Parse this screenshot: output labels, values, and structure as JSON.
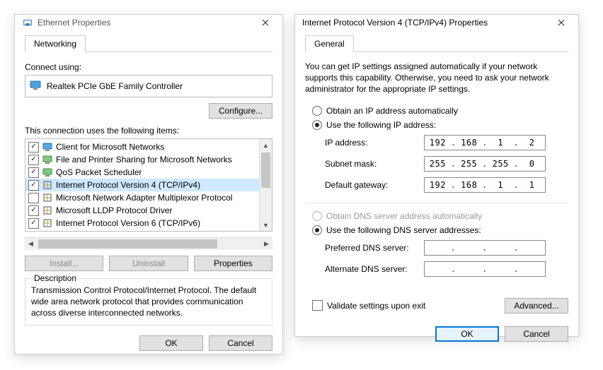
{
  "left": {
    "title": "Ethernet Properties",
    "tab": "Networking",
    "connect_using_label": "Connect using:",
    "adapter": "Realtek PCIe GbE Family Controller",
    "configure_btn": "Configure...",
    "items_label": "This connection uses the following items:",
    "items": [
      {
        "checked": true,
        "icon": "client",
        "label": "Client for Microsoft Networks",
        "selected": false
      },
      {
        "checked": true,
        "icon": "service",
        "label": "File and Printer Sharing for Microsoft Networks",
        "selected": false
      },
      {
        "checked": true,
        "icon": "service",
        "label": "QoS Packet Scheduler",
        "selected": false
      },
      {
        "checked": true,
        "icon": "protocol",
        "label": "Internet Protocol Version 4 (TCP/IPv4)",
        "selected": true
      },
      {
        "checked": false,
        "icon": "protocol",
        "label": "Microsoft Network Adapter Multiplexor Protocol",
        "selected": false
      },
      {
        "checked": true,
        "icon": "protocol",
        "label": "Microsoft LLDP Protocol Driver",
        "selected": false
      },
      {
        "checked": true,
        "icon": "protocol",
        "label": "Internet Protocol Version 6 (TCP/IPv6)",
        "selected": false
      }
    ],
    "install_btn": "Install...",
    "uninstall_btn": "Uninstall",
    "properties_btn": "Properties",
    "description_legend": "Description",
    "description_text": "Transmission Control Protocol/Internet Protocol. The default wide area network protocol that provides communication across diverse interconnected networks.",
    "ok_btn": "OK",
    "cancel_btn": "Cancel"
  },
  "right": {
    "title": "Internet Protocol Version 4 (TCP/IPv4) Properties",
    "tab": "General",
    "intro": "You can get IP settings assigned automatically if your network supports this capability. Otherwise, you need to ask your network administrator for the appropriate IP settings.",
    "ip_auto_label": "Obtain an IP address automatically",
    "ip_manual_label": "Use the following IP address:",
    "ip_label": "IP address:",
    "ip_value": [
      "192",
      "168",
      "1",
      "2"
    ],
    "mask_label": "Subnet mask:",
    "mask_value": [
      "255",
      "255",
      "255",
      "0"
    ],
    "gw_label": "Default gateway:",
    "gw_value": [
      "192",
      "168",
      "1",
      "1"
    ],
    "dns_auto_label": "Obtain DNS server address automatically",
    "dns_manual_label": "Use the following DNS server addresses:",
    "pdns_label": "Preferred DNS server:",
    "pdns_value": [
      "",
      "",
      "",
      ""
    ],
    "adns_label": "Alternate DNS server:",
    "adns_value": [
      "",
      "",
      "",
      ""
    ],
    "validate_label": "Validate settings upon exit",
    "advanced_btn": "Advanced...",
    "ok_btn": "OK",
    "cancel_btn": "Cancel"
  }
}
